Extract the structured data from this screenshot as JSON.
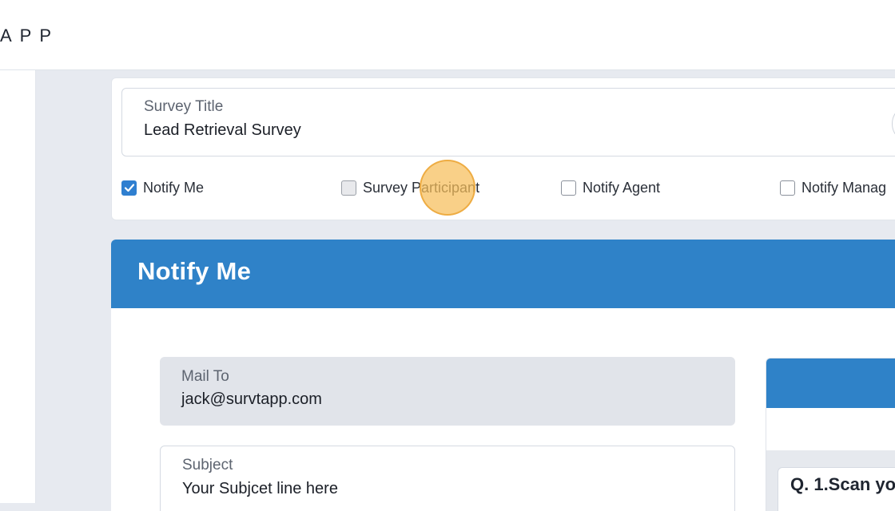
{
  "brand": {
    "text": "APP"
  },
  "survey": {
    "title_label": "Survey Title",
    "title_value": "Lead Retrieval Survey"
  },
  "checkboxes": [
    {
      "label": "Notify Me",
      "checked": true
    },
    {
      "label": "Survey Participant",
      "checked": false
    },
    {
      "label": "Notify Agent",
      "checked": false
    },
    {
      "label": "Notify Manag",
      "checked": false
    }
  ],
  "notify_section": {
    "title": "Notify Me",
    "mail_to_label": "Mail To",
    "mail_to_value": "jack@survtapp.com",
    "subject_label": "Subject",
    "subject_value": "Your Subjcet line here"
  },
  "question_preview": {
    "text": "Q. 1.Scan yo"
  },
  "colors": {
    "accent": "#2f82c8",
    "checkbox_checked": "#2f7fd0",
    "click_marker": "#f7be5a"
  }
}
